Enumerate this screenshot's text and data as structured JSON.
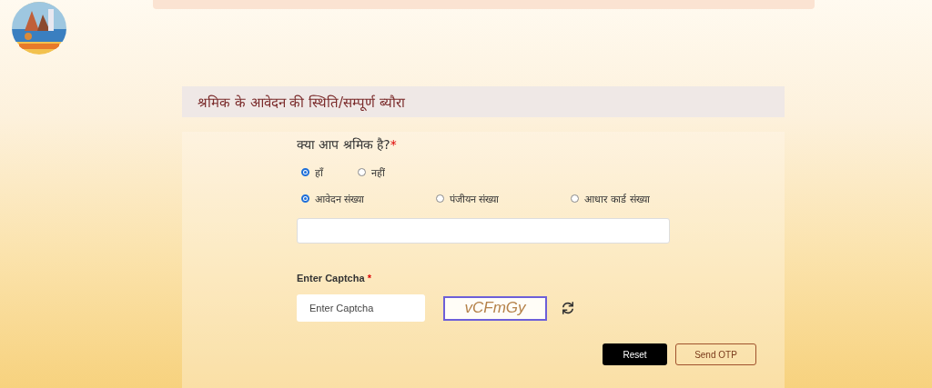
{
  "section_title": "श्रमिक के आवेदन की स्थिति/सम्पूर्ण ब्यौरा",
  "question": {
    "label": "क्या आप श्रमिक है?",
    "required_mark": "*"
  },
  "worker_options": [
    {
      "label": "हाँ",
      "selected": true
    },
    {
      "label": "नहीं",
      "selected": false
    }
  ],
  "id_options": [
    {
      "label": "आवेदन संख्या",
      "selected": true
    },
    {
      "label": "पंजीयन संख्या",
      "selected": false
    },
    {
      "label": "आधार कार्ड संख्या",
      "selected": false
    }
  ],
  "captcha": {
    "label": "Enter Captcha",
    "required_mark": "*",
    "placeholder": "Enter Captcha",
    "code": "vCFmGy"
  },
  "buttons": [
    {
      "label": "Reset",
      "kind": "primary"
    },
    {
      "label": "Send OTP",
      "kind": "outline"
    }
  ]
}
